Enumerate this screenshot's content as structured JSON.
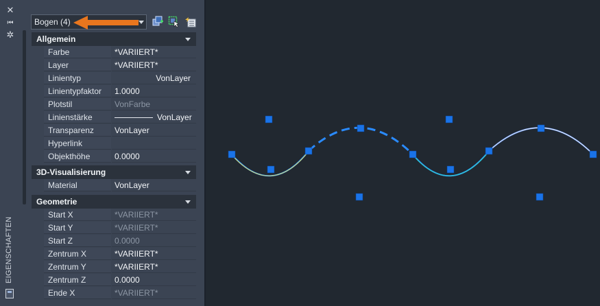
{
  "sidebar": {
    "close_glyph": "✕",
    "pin_glyph": "⏮",
    "settings_glyph": "✲",
    "title": "EIGENSCHAFTEN"
  },
  "selector": {
    "value": "Bogen (4)"
  },
  "sections": [
    {
      "title": "Allgemein",
      "rows": [
        {
          "label": "Farbe",
          "value": "*VARIIERT*"
        },
        {
          "label": "Layer",
          "value": "*VARIIERT*"
        },
        {
          "label": "Linientyp",
          "value": "VonLayer"
        },
        {
          "label": "Linientypfaktor",
          "value": "1.0000"
        },
        {
          "label": "Plotstil",
          "value": "VonFarbe"
        },
        {
          "label": "Linienstärke",
          "value": "VonLayer"
        },
        {
          "label": "Transparenz",
          "value": "VonLayer"
        },
        {
          "label": "Hyperlink",
          "value": ""
        },
        {
          "label": "Objekthöhe",
          "value": "0.0000"
        }
      ]
    },
    {
      "title": "3D-Visualisierung",
      "rows": [
        {
          "label": "Material",
          "value": "VonLayer"
        }
      ]
    },
    {
      "title": "Geometrie",
      "rows": [
        {
          "label": "Start X",
          "value": "*VARIIERT*"
        },
        {
          "label": "Start Y",
          "value": "*VARIIERT*"
        },
        {
          "label": "Start Z",
          "value": "0.0000"
        },
        {
          "label": "Zentrum X",
          "value": "*VARIIERT*"
        },
        {
          "label": "Zentrum Y",
          "value": "*VARIIERT*"
        },
        {
          "label": "Zentrum Z",
          "value": "0.0000"
        },
        {
          "label": "Ende X",
          "value": "*VARIIERT*"
        }
      ]
    }
  ],
  "colors": {
    "panel_bg": "#3b4453",
    "canvas_bg": "#212830",
    "grip": "#1a73e8",
    "arrow": "#e8761e",
    "arc_selected": "#3aa0ff",
    "arc_yellow": "#d8e07a",
    "arc_cyan": "#2fd3c8"
  }
}
